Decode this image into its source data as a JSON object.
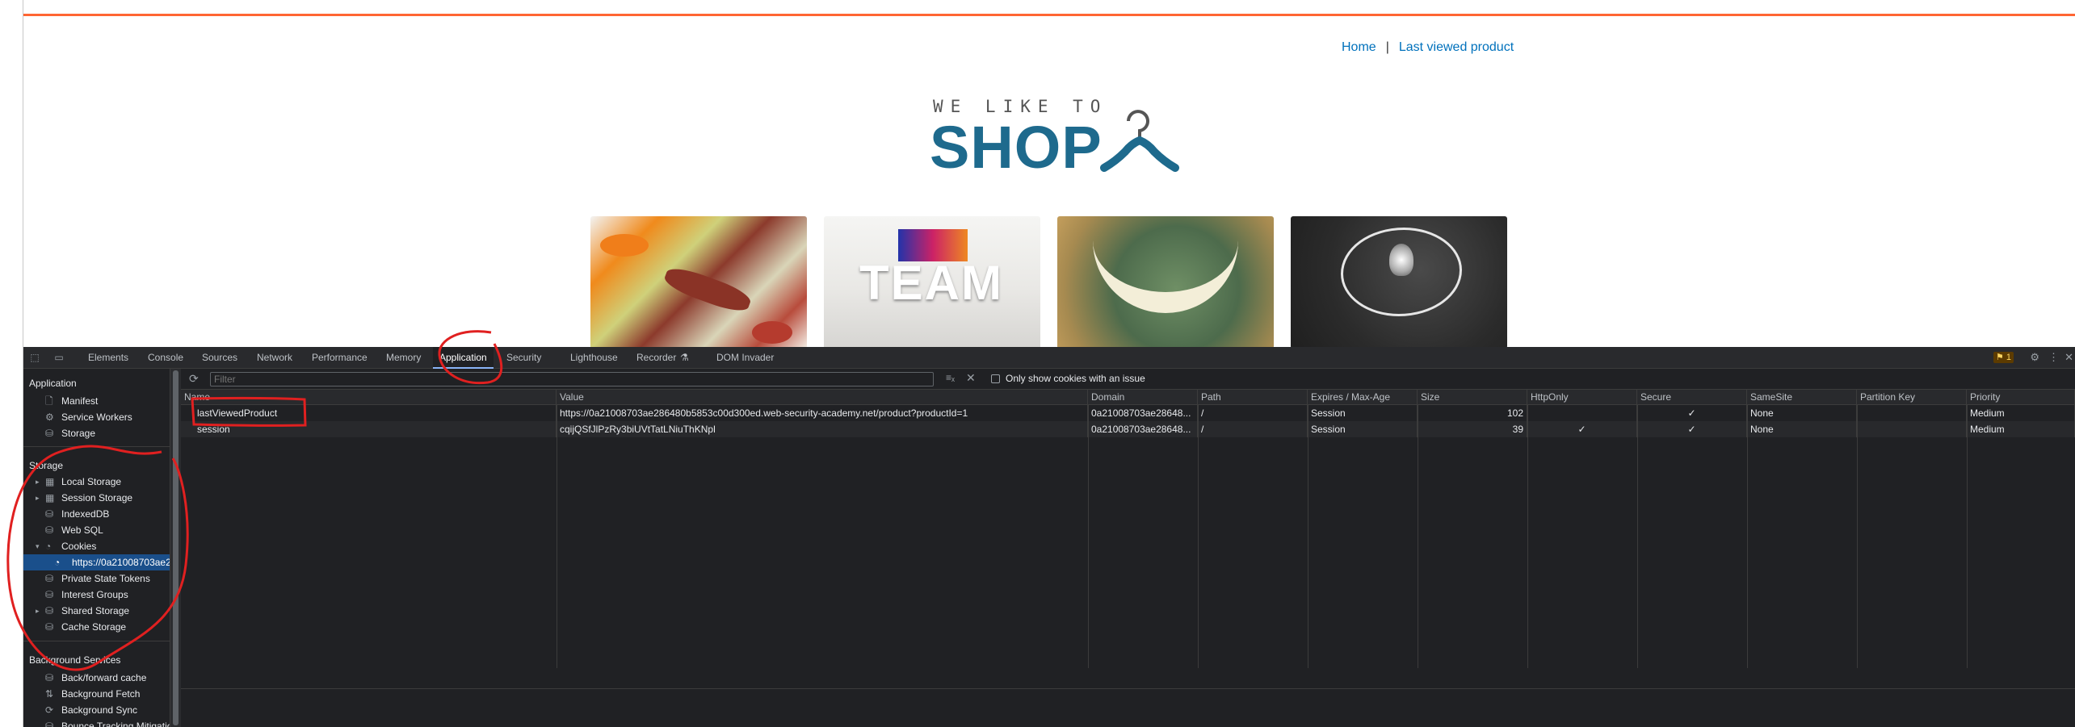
{
  "site": {
    "nav": {
      "home": "Home",
      "separator": "|",
      "last_viewed": "Last viewed product"
    },
    "logo": {
      "tagline": "WE LIKE TO",
      "title": "SHOP"
    },
    "products": [
      {
        "text": ""
      },
      {
        "text": "TEAM"
      },
      {
        "text": ""
      },
      {
        "text": ""
      }
    ]
  },
  "devtools": {
    "tabs": [
      "Elements",
      "Console",
      "Sources",
      "Network",
      "Performance",
      "Memory",
      "Application",
      "Security",
      "Lighthouse",
      "Recorder",
      "DOM Invader"
    ],
    "active_tab": "Application",
    "issues_badge": "1",
    "sidebar": {
      "application_header": "Application",
      "application_items": [
        {
          "label": "Manifest",
          "icon": "file-icon"
        },
        {
          "label": "Service Workers",
          "icon": "gear-icon"
        },
        {
          "label": "Storage",
          "icon": "database-icon"
        }
      ],
      "storage_header": "Storage",
      "storage_items": [
        {
          "label": "Local Storage",
          "icon": "table-icon",
          "arrow": "▸"
        },
        {
          "label": "Session Storage",
          "icon": "table-icon",
          "arrow": "▸"
        },
        {
          "label": "IndexedDB",
          "icon": "database-icon",
          "arrow": ""
        },
        {
          "label": "Web SQL",
          "icon": "database-icon",
          "arrow": ""
        },
        {
          "label": "Cookies",
          "icon": "cookie-icon",
          "arrow": "▾"
        },
        {
          "label": "https://0a21008703ae2",
          "icon": "cookie-icon",
          "arrow": ""
        },
        {
          "label": "Private State Tokens",
          "icon": "database-icon",
          "arrow": ""
        },
        {
          "label": "Interest Groups",
          "icon": "database-icon",
          "arrow": ""
        },
        {
          "label": "Shared Storage",
          "icon": "database-icon",
          "arrow": "▸"
        },
        {
          "label": "Cache Storage",
          "icon": "database-icon",
          "arrow": ""
        }
      ],
      "background_header": "Background Services",
      "background_items": [
        {
          "label": "Back/forward cache",
          "icon": "database-icon"
        },
        {
          "label": "Background Fetch",
          "icon": "fetch-icon"
        },
        {
          "label": "Background Sync",
          "icon": "sync-icon"
        },
        {
          "label": "Bounce Tracking Mitigatio",
          "icon": "database-icon"
        }
      ]
    },
    "toolbar": {
      "filter_placeholder": "Filter",
      "only_issues_label": "Only show cookies with an issue"
    },
    "cookies_table": {
      "columns": [
        "Name",
        "Value",
        "Domain",
        "Path",
        "Expires / Max-Age",
        "Size",
        "HttpOnly",
        "Secure",
        "SameSite",
        "Partition Key",
        "Priority"
      ],
      "rows": [
        [
          "lastViewedProduct",
          "https://0a21008703ae286480b5853c00d300ed.web-security-academy.net/product?productId=1",
          "0a21008703ae28648...",
          "/",
          "Session",
          "102",
          "",
          "✓",
          "None",
          "",
          "Medium"
        ],
        [
          "session",
          "cqijQSfJlPzRy3biUVtTatLNiuThKNpl",
          "0a21008703ae28648...",
          "/",
          "Session",
          "39",
          "✓",
          "✓",
          "None",
          "",
          "Medium"
        ]
      ]
    }
  },
  "colors": {
    "accent_orange": "#ff6633",
    "brand_blue": "#1e6a8d",
    "annotation_red": "#e02020"
  }
}
